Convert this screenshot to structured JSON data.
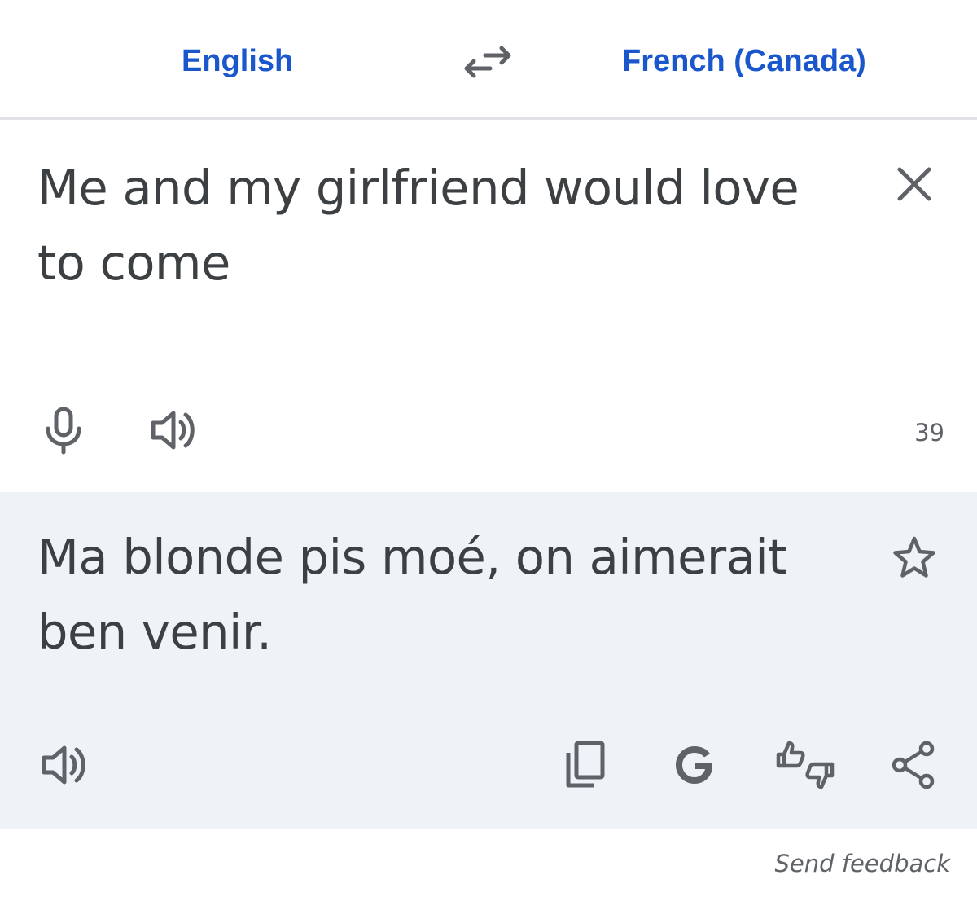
{
  "language_bar": {
    "source_language": "English",
    "target_language": "French (Canada)",
    "swap_icon": "swap-arrows-icon"
  },
  "source": {
    "text": "Me and my girlfriend would love to come",
    "char_count": "39",
    "icons": [
      "close-icon",
      "microphone-icon",
      "speaker-icon"
    ]
  },
  "target": {
    "text": "Ma blonde pis moé, on aimerait ben venir.",
    "icons": [
      "star-icon",
      "speaker-icon",
      "copy-icon",
      "google-g-icon",
      "thumbs-up-down-icon",
      "share-icon"
    ]
  },
  "footer": {
    "send_feedback": "Send feedback"
  },
  "colors": {
    "accent_blue": "#1a56cc",
    "text": "#3c4043",
    "icon_gray": "#5f6368",
    "target_bg": "#eff2f7",
    "divider": "#dfe1e5"
  }
}
